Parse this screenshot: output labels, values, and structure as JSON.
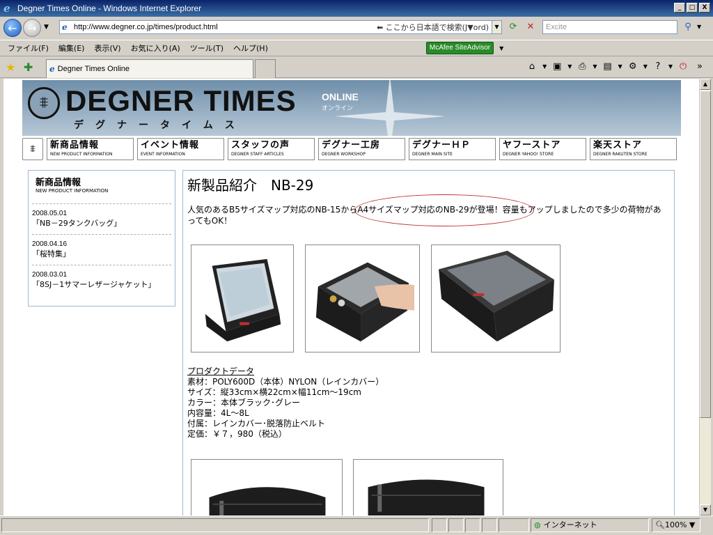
{
  "window": {
    "title": "Degner Times Online - Windows Internet Explorer",
    "controls": {
      "minimize": "_",
      "maximize": "□",
      "close": "X"
    }
  },
  "address_bar": {
    "url": "http://www.degner.co.jp/times/product.html",
    "hint": "⬅ ここから日本語で検索(J▼ord)",
    "search_placeholder": "Excite"
  },
  "menu": {
    "items": [
      "ファイル(F)",
      "編集(E)",
      "表示(V)",
      "お気に入り(A)",
      "ツール(T)",
      "ヘルプ(H)"
    ],
    "mcafee_label": "McAfee SiteAdvisor"
  },
  "tabs": [
    {
      "label": "Degner Times Online"
    }
  ],
  "site": {
    "banner": {
      "title": "DEGNER TIMES",
      "online": "ONLINE",
      "online_kana": "オンライン",
      "kana": "デグナータイムス"
    },
    "nav": [
      {
        "jp": "新商品情報",
        "en": "NEW PRODUCT INFORMATION"
      },
      {
        "jp": "イベント情報",
        "en": "EVENT INFORMATION"
      },
      {
        "jp": "スタッフの声",
        "en": "DEGNER STAFF ARTICLES"
      },
      {
        "jp": "デグナー工房",
        "en": "DEGNER WORKSHOP"
      },
      {
        "jp": "デグナーＨＰ",
        "en": "DEGNER MAIN SITE"
      },
      {
        "jp": "ヤフーストア",
        "en": "DEGNER YAHOO! STORE"
      },
      {
        "jp": "楽天ストア",
        "en": "DEGNER RAKUTEN STORE"
      }
    ],
    "sidebar": {
      "heading_jp": "新商品情報",
      "heading_en": "NEW PRODUCT INFORMATION",
      "entries": [
        {
          "date": "2008.05.01",
          "title": "「NB－29タンクバッグ」"
        },
        {
          "date": "2008.04.16",
          "title": "「桜特集」"
        },
        {
          "date": "2008.03.01",
          "title": "「8SJ－1サマーレザージャケット」"
        }
      ]
    },
    "main": {
      "title": "新製品紹介　NB-29",
      "intro": "人気のあるB5サイズマップ対応のNB-15からA4サイズマップ対応のNB-29が登場！容量もアップしましたので多少の荷物があってもOK！",
      "spec": {
        "title": "プロダクトデータ",
        "lines": [
          "素材：POLY600D（本体）NYLON（レインカバー）",
          "サイズ：縦33cm×横22cm×幅11cm～19cm",
          "カラー：本体ブラック･グレー",
          "内容量：4L～8L",
          "付属：レインカバー･脱落防止ベルト",
          "定価：￥７，980（税込）"
        ]
      }
    }
  },
  "status_bar": {
    "zone": "インターネット",
    "zoom": "100%"
  },
  "colors": {
    "titlebar": "#0a246a",
    "banner": "#7f9bb3",
    "highlight": "#c43030",
    "border": "#9ab8cf"
  }
}
